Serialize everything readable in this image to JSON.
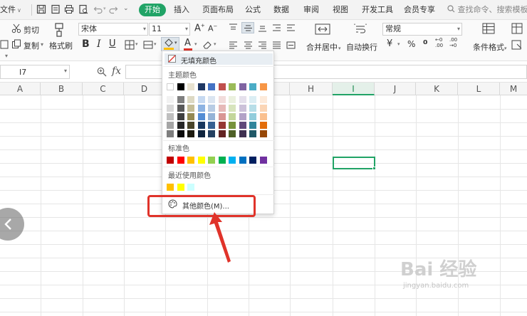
{
  "menubar": {
    "file": "文件",
    "tabs": [
      "开始",
      "插入",
      "页面布局",
      "公式",
      "数据",
      "审阅",
      "视图",
      "开发工具",
      "会员专享"
    ],
    "search_placeholder": "查找命令、搜索模板"
  },
  "ribbon": {
    "cut": "剪切",
    "copy": "复制",
    "format_painter": "格式刷",
    "font_name": "宋体",
    "font_size": "11",
    "merge_center": "合并居中",
    "wrap_text": "自动换行",
    "number_format": "常规",
    "conditional_format": "条件格式"
  },
  "formula_bar": {
    "cell_ref": "I7",
    "fx": "fx"
  },
  "grid": {
    "columns": [
      "A",
      "B",
      "C",
      "D",
      "E",
      "F",
      "G",
      "H",
      "I",
      "J",
      "K",
      "L",
      "M"
    ],
    "selected_column": "I",
    "selected_cell": "I7"
  },
  "fill_dropdown": {
    "no_fill": "无填充颜色",
    "theme_colors_label": "主题颜色",
    "theme_top_row": [
      "#ffffff",
      "#000000",
      "#e8e2d0",
      "#1f3864",
      "#4472c4",
      "#c0504d",
      "#9bbb59",
      "#8064a2",
      "#4bacc6",
      "#f79646"
    ],
    "theme_shades": [
      [
        "#f2f2f2",
        "#7f7f7f",
        "#ddd9c3",
        "#c6d9f1",
        "#dbe5f1",
        "#f2dcdb",
        "#ebf1de",
        "#e5e0ec",
        "#dbeef4",
        "#fdeada"
      ],
      [
        "#d8d8d8",
        "#595959",
        "#c4bd97",
        "#8db3e2",
        "#b8cce4",
        "#e6b9b8",
        "#d7e4bc",
        "#ccc1d9",
        "#b7dee8",
        "#fbd5b5"
      ],
      [
        "#bfbfbf",
        "#3f3f3f",
        "#938953",
        "#548dd4",
        "#95b3d7",
        "#d99694",
        "#c3d69b",
        "#b2a2c7",
        "#92cddc",
        "#fac08f"
      ],
      [
        "#a5a5a5",
        "#262626",
        "#494429",
        "#17365d",
        "#366092",
        "#953734",
        "#76923c",
        "#5f497a",
        "#31859b",
        "#e36c09"
      ],
      [
        "#7f7f7f",
        "#0c0c0c",
        "#1d1b10",
        "#0f243e",
        "#244061",
        "#632423",
        "#4f6128",
        "#3f3151",
        "#205867",
        "#974806"
      ]
    ],
    "standard_label": "标准色",
    "standard_colors": [
      "#c00000",
      "#ff0000",
      "#ffc000",
      "#ffff00",
      "#92d050",
      "#00b050",
      "#00b0f0",
      "#0070c0",
      "#002060",
      "#7030a0"
    ],
    "recent_label": "最近使用颜色",
    "recent_colors": [
      "#ffc000",
      "#ffff00",
      "#ccffff"
    ],
    "more_colors": "其他颜色(M)..."
  },
  "watermark": {
    "text": "Bai 经验",
    "url": "jingyan.baidu.com"
  },
  "colors": {
    "accent_green": "#21a366",
    "annotation_red": "#e0332a"
  }
}
